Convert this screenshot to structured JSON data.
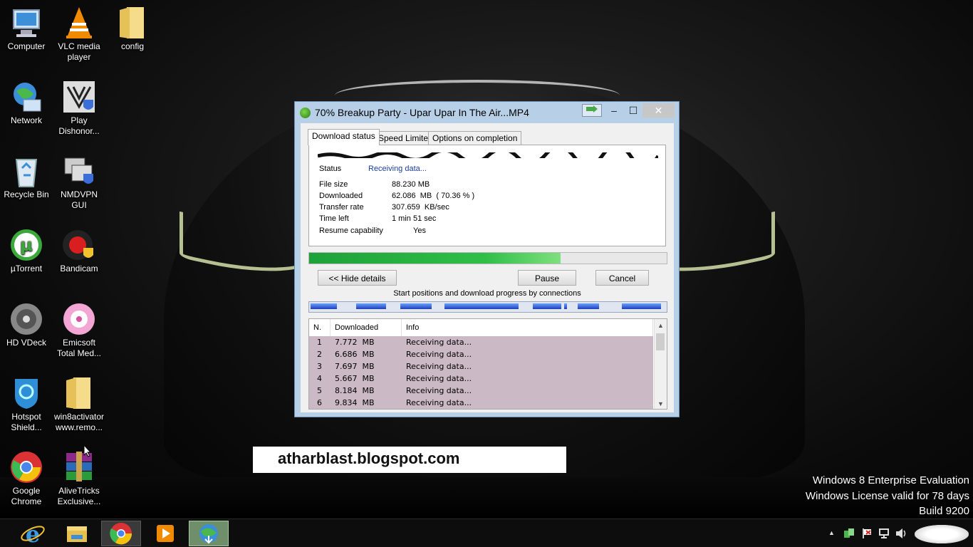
{
  "desktop": {
    "icons": [
      {
        "label": "Computer",
        "icon": "computer-icon"
      },
      {
        "label": "VLC media player",
        "icon": "vlc-icon"
      },
      {
        "label": "config",
        "icon": "folder-icon"
      },
      {
        "label": "Network",
        "icon": "network-icon"
      },
      {
        "label": "Play Dishonor...",
        "icon": "dishonored-icon"
      },
      {
        "label": "Recycle Bin",
        "icon": "recycle-bin-icon"
      },
      {
        "label": "NMDVPN GUI",
        "icon": "vpn-icon"
      },
      {
        "label": "µTorrent",
        "icon": "utorrent-icon"
      },
      {
        "label": "Bandicam",
        "icon": "bandicam-icon"
      },
      {
        "label": "HD VDeck",
        "icon": "hdvdeck-icon"
      },
      {
        "label": "Emicsoft Total Med...",
        "icon": "emicsoft-icon"
      },
      {
        "label": "Hotspot Shield...",
        "icon": "hotspot-shield-icon"
      },
      {
        "label": "win8activator www.remo...",
        "icon": "folder-icon"
      },
      {
        "label": "Google Chrome",
        "icon": "chrome-icon"
      },
      {
        "label": "AliveTricks Exclusive...",
        "icon": "winrar-icon"
      }
    ],
    "banner_text": "atharblast.blogspot.com",
    "watermark": [
      "Windows 8 Enterprise Evaluation",
      "Windows License valid for 78 days",
      "Build 9200"
    ]
  },
  "idm": {
    "title": "70% Breakup Party - Upar Upar In The Air...MP4",
    "titlebar_buttons": {
      "minimize": "–",
      "maximize": "☐",
      "close": "✕"
    },
    "tabs": [
      "Download status",
      "Speed Limiter",
      "Options on completion"
    ],
    "info": {
      "status_label": "Status",
      "status_value": "Receiving data...",
      "file_size_label": "File size",
      "file_size_value": "88.230  MB",
      "downloaded_label": "Downloaded",
      "downloaded_value": "62.086  MB  ( 70.36 % )",
      "transfer_label": "Transfer rate",
      "transfer_value": "307.659  KB/sec",
      "time_left_label": "Time left",
      "time_left_value": "1 min 51 sec",
      "resume_label": "Resume capability",
      "resume_value": "Yes"
    },
    "progress_fraction": 0.7036,
    "buttons": {
      "hide_details": "<< Hide details",
      "pause": "Pause",
      "cancel": "Cancel"
    },
    "connections_caption": "Start positions and download progress by connections",
    "connections_table": {
      "headers": [
        "N.",
        "Downloaded",
        "Info"
      ],
      "rows": [
        {
          "n": "1",
          "downloaded": "7.772  MB",
          "info": "Receiving data..."
        },
        {
          "n": "2",
          "downloaded": "6.686  MB",
          "info": "Receiving data..."
        },
        {
          "n": "3",
          "downloaded": "7.697  MB",
          "info": "Receiving data..."
        },
        {
          "n": "4",
          "downloaded": "5.667  MB",
          "info": "Receiving data..."
        },
        {
          "n": "5",
          "downloaded": "8.184  MB",
          "info": "Receiving data..."
        },
        {
          "n": "6",
          "downloaded": "9.834  MB",
          "info": "Receiving data..."
        }
      ]
    }
  },
  "taskbar": {
    "items": [
      "internet-explorer-icon",
      "file-explorer-icon",
      "chrome-icon",
      "media-player-icon",
      "idm-icon"
    ],
    "tray": [
      "show-hidden-icons",
      "network-tray-icon",
      "action-center-icon",
      "network-status-icon",
      "volume-icon"
    ]
  },
  "colors": {
    "progress": "#2fbf47",
    "conn_segment": "#1f3fb8",
    "row_highlight": "#cbb9c5"
  }
}
